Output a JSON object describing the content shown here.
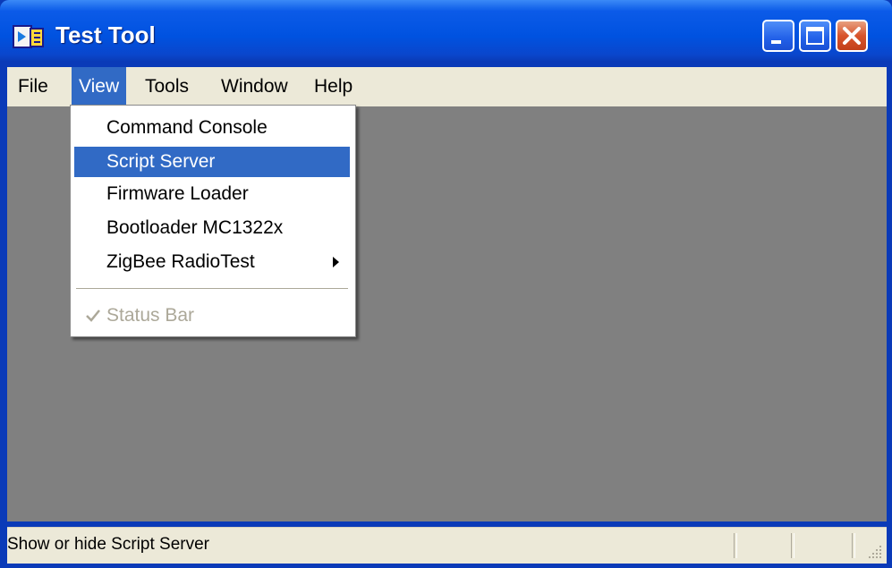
{
  "window": {
    "title": "Test Tool",
    "app_icon": "test-tool-app-icon",
    "controls": [
      "minimize-icon",
      "maximize-icon",
      "close-icon"
    ]
  },
  "menubar": {
    "items": [
      {
        "label": "File"
      },
      {
        "label": "View",
        "active": true
      },
      {
        "label": "Tools"
      },
      {
        "label": "Window"
      },
      {
        "label": "Help"
      }
    ]
  },
  "view_menu": {
    "items": [
      {
        "label": "Command Console"
      },
      {
        "label": "Script Server",
        "highlighted": true
      },
      {
        "label": "Firmware Loader"
      },
      {
        "label": "Bootloader MC1322x"
      },
      {
        "label": "ZigBee RadioTest",
        "submenu": true
      },
      {
        "label": "Status Bar",
        "checked": true,
        "disabled": true
      }
    ]
  },
  "statusbar": {
    "text": "Show or hide Script Server"
  },
  "colors": {
    "titlebar": "#0052e0",
    "highlight": "#316ac5",
    "client_background": "#808080",
    "chrome": "#ece9d8"
  }
}
